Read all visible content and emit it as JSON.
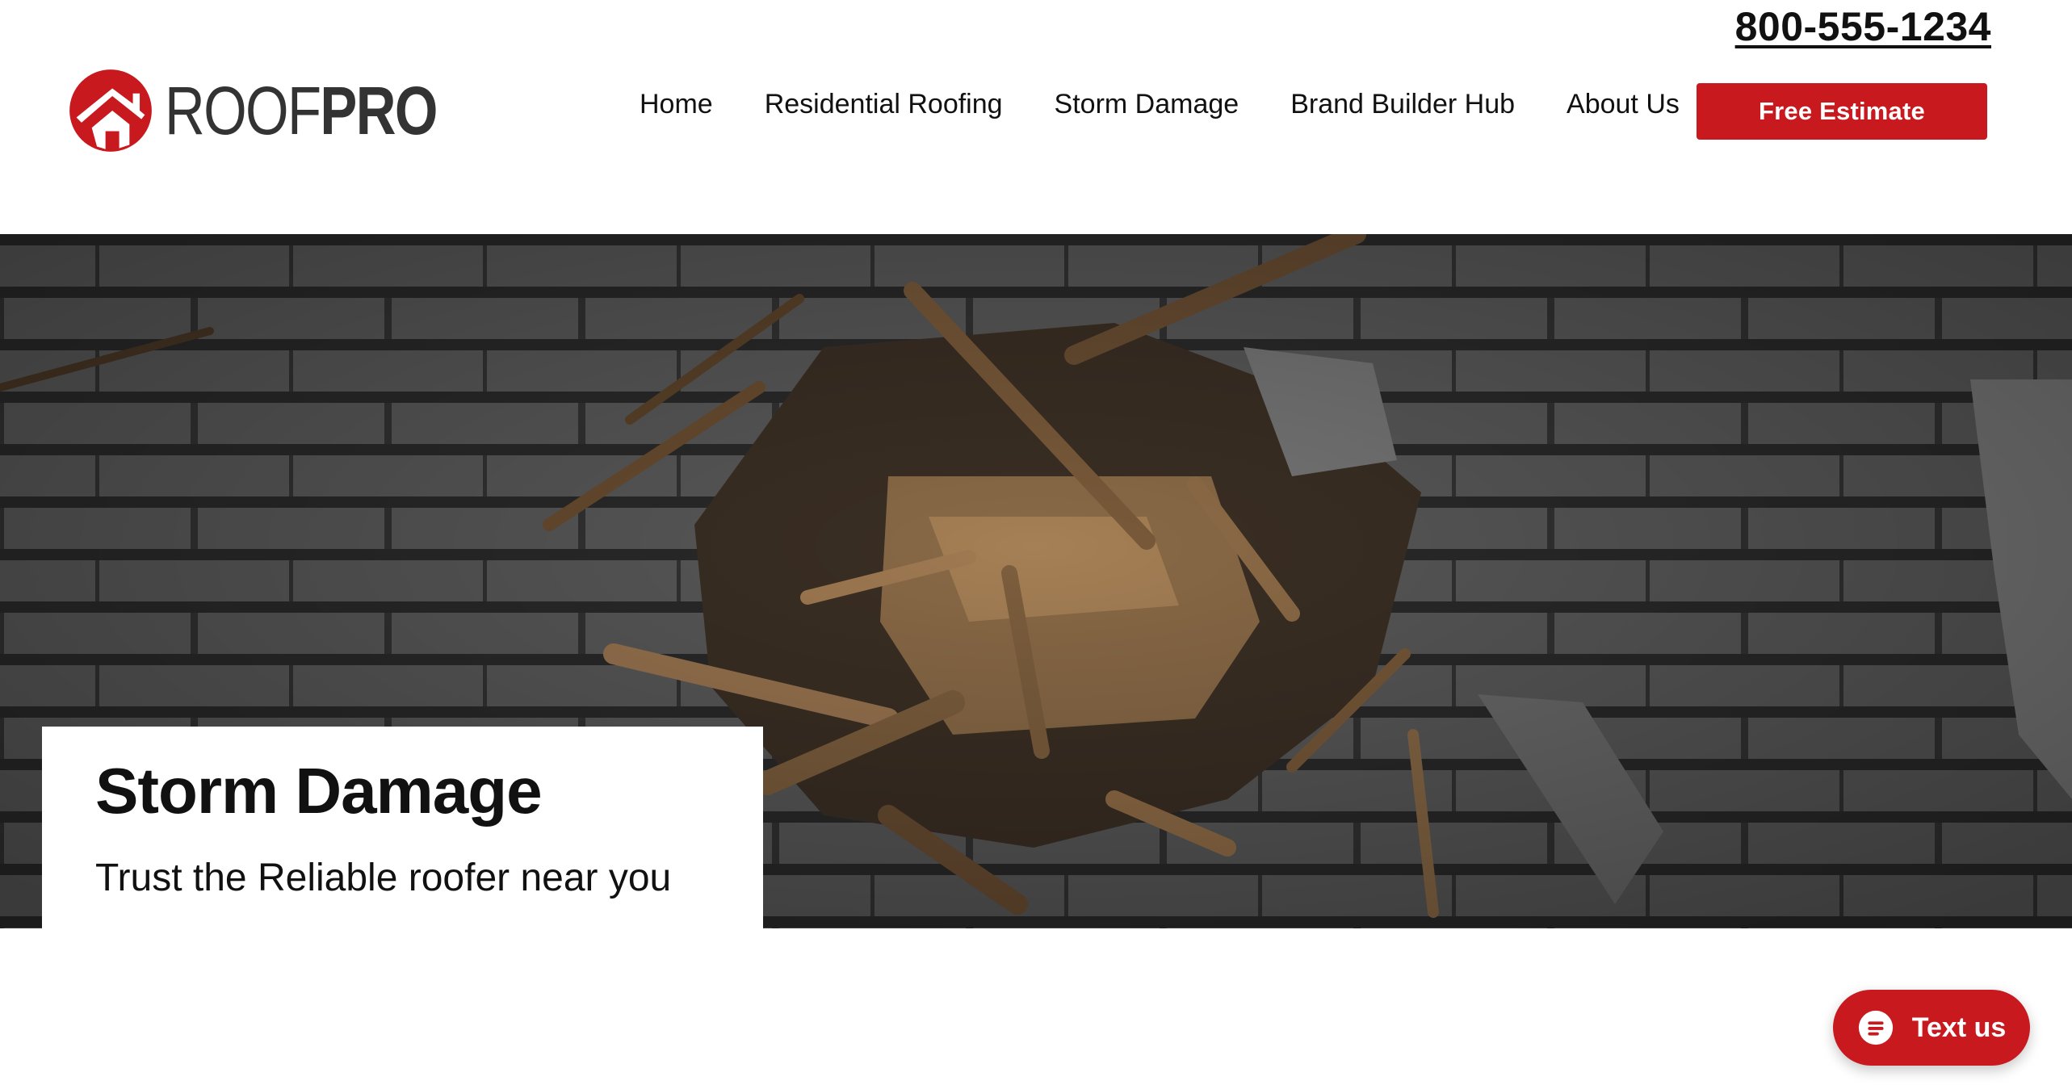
{
  "phone": "800-555-1234",
  "logo": {
    "roof": "ROOF",
    "pro": "PRO"
  },
  "nav": {
    "items": [
      "Home",
      "Residential Roofing",
      "Storm Damage",
      "Brand Builder Hub",
      "About Us"
    ],
    "cta": "Free Estimate"
  },
  "hero": {
    "title": "Storm Damage",
    "subtitle": "Trust the Reliable roofer near you"
  },
  "chat": {
    "label": "Text us"
  },
  "colors": {
    "brand_red": "#c8191f",
    "text": "#111111",
    "background": "#ffffff"
  }
}
